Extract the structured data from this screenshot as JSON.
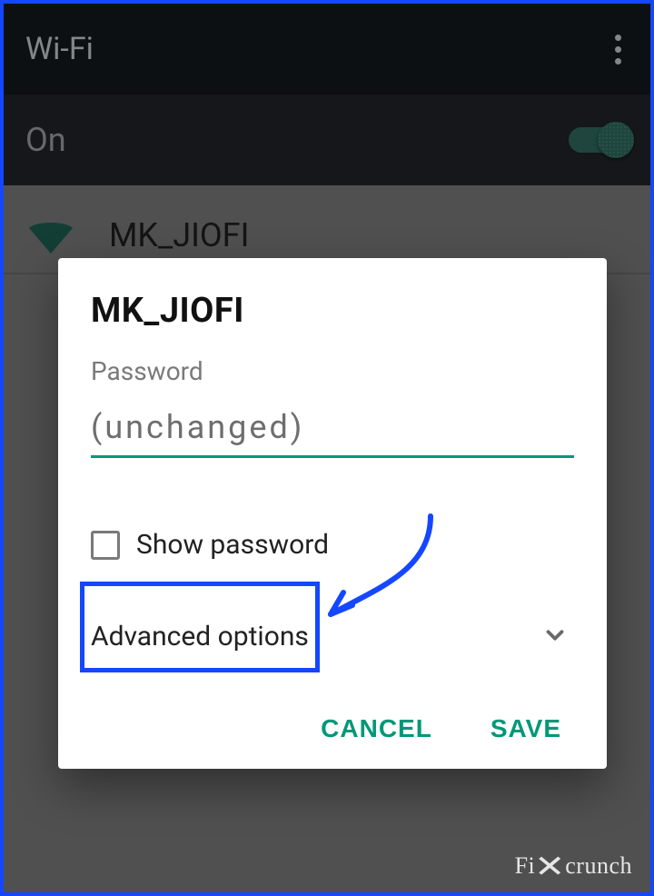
{
  "appbar": {
    "title": "Wi-Fi"
  },
  "wifi_toggle": {
    "label": "On",
    "on": true
  },
  "bg_network": {
    "ssid": "MK_JIOFI"
  },
  "dialog": {
    "title": "MK_JIOFI",
    "password_label": "Password",
    "password_placeholder": "(unchanged)",
    "show_password_label": "Show password",
    "advanced_label": "Advanced options",
    "cancel": "CANCEL",
    "save": "SAVE"
  },
  "colors": {
    "accent": "#009878",
    "highlight": "#1447ff"
  },
  "watermark": {
    "left": "Fi",
    "right": "crunch"
  }
}
